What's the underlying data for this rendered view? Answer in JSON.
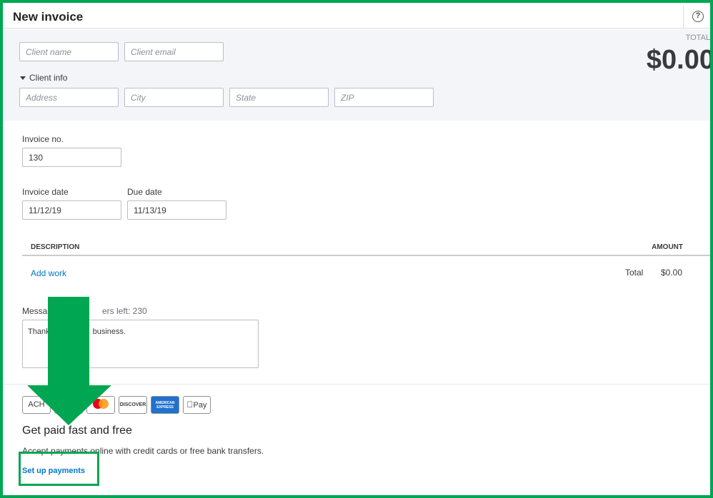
{
  "header": {
    "title": "New invoice",
    "help_symbol": "?"
  },
  "client": {
    "name_placeholder": "Client name",
    "email_placeholder": "Client email",
    "info_toggle": "Client info",
    "address_placeholder": "Address",
    "city_placeholder": "City",
    "state_placeholder": "State",
    "zip_placeholder": "ZIP"
  },
  "summary": {
    "total_label": "TOTAL",
    "total_amount": "$0.00"
  },
  "invoice": {
    "number_label": "Invoice no.",
    "number_value": "130",
    "date_label": "Invoice date",
    "date_value": "11/12/19",
    "due_label": "Due date",
    "due_value": "11/13/19"
  },
  "table": {
    "col_description": "DESCRIPTION",
    "col_amount": "AMOUNT",
    "add_work": "Add work",
    "total_label": "Total",
    "total_value": "$0.00"
  },
  "message": {
    "label": "Message",
    "chars_left": "ers left: 230",
    "text_start": "Thank",
    "text_end": "business."
  },
  "payments": {
    "card_ach": "ACH",
    "card_discover": "DISCOVER",
    "card_amex": "AMERICAN EXPRESS",
    "card_applepay": "Pay",
    "title": "Get paid fast and free",
    "subtitle": "Accept payments online with credit cards or free bank transfers.",
    "setup_link": "Set up payments"
  },
  "colors": {
    "annotation_green": "#00a651",
    "link_blue": "#0077c5",
    "panel_gray": "#f4f5f8"
  }
}
